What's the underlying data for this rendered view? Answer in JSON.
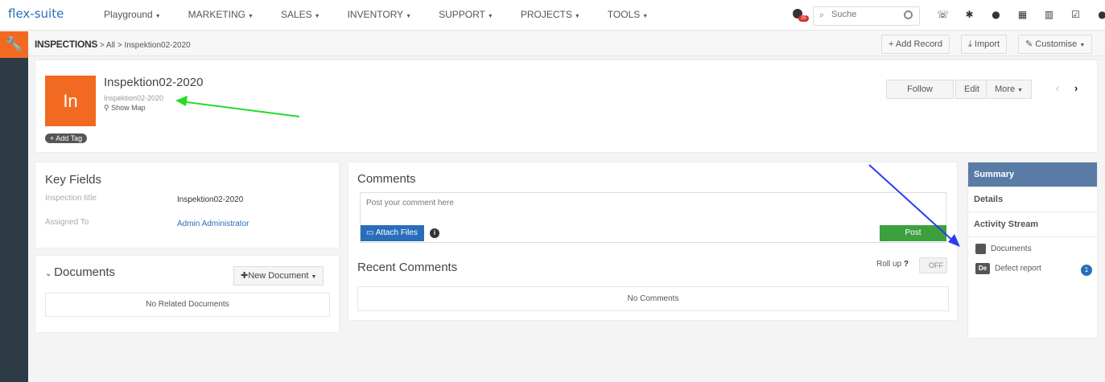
{
  "app": {
    "logo": "flex-suite"
  },
  "nav": {
    "items": [
      "Playground",
      "MARKETING",
      "SALES",
      "INVENTORY",
      "SUPPORT",
      "PROJECTS",
      "TOOLS"
    ],
    "notification_count": "25",
    "search_placeholder": "Suche",
    "icons": [
      "phone-icon",
      "gear-icon",
      "circle-icon",
      "calendar-icon",
      "chart-icon",
      "checkbox-icon",
      "user-icon"
    ]
  },
  "breadcrumb": {
    "module": "INSPECTIONS",
    "all": "All",
    "record": "Inspektion02-2020"
  },
  "header_buttons": {
    "add_record": "+ Add Record",
    "import": "Import",
    "customise": "Customise"
  },
  "record": {
    "avatar": "In",
    "title": "Inspektion02-2020",
    "subtitle": "Inspektion02-2020",
    "show_map": "Show Map",
    "add_tag": "+ Add Tag",
    "follow": "Follow",
    "edit": "Edit",
    "more": "More"
  },
  "key_fields": {
    "title": "Key Fields",
    "rows": [
      {
        "label": "Inspection title",
        "value": "Inspektion02-2020"
      },
      {
        "label": "Assigned To",
        "value": "Admin Administrator"
      }
    ]
  },
  "documents": {
    "title": "Documents",
    "new_button": "New Document",
    "empty": "No Related Documents"
  },
  "comments": {
    "title": "Comments",
    "placeholder": "Post your comment here",
    "attach": "Attach Files",
    "post": "Post",
    "recent_title": "Recent Comments",
    "rollup": "Roll up",
    "toggle": "OFF",
    "empty": "No Comments"
  },
  "right_panel": {
    "tabs": [
      "Summary",
      "Details",
      "Activity Stream"
    ],
    "items": [
      {
        "label": "Documents",
        "icon": "document-icon"
      },
      {
        "label": "Defect report",
        "abbr": "De",
        "count": "1"
      }
    ]
  },
  "colors": {
    "accent": "#f26a22",
    "primary": "#2a6ebb",
    "success": "#3ca13d",
    "sidebar": "#2d3b47",
    "active_tab": "#5a7ba6"
  }
}
